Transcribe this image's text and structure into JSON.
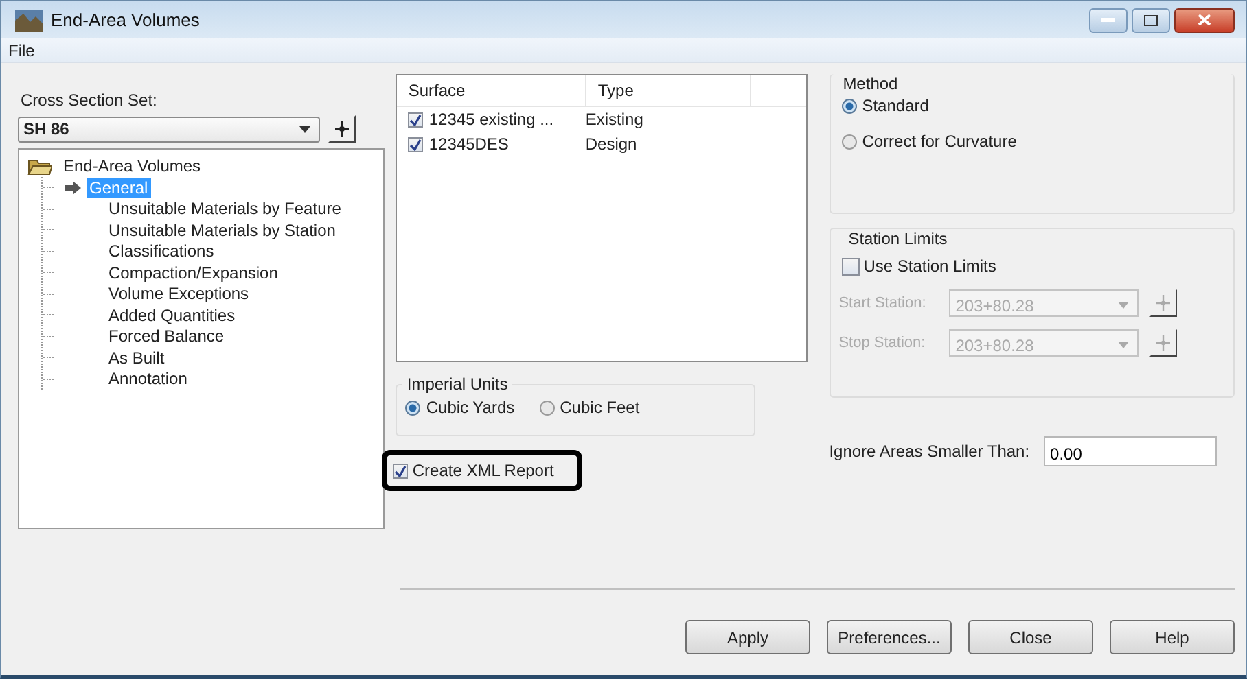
{
  "window": {
    "title": "End-Area Volumes"
  },
  "menu": [
    "File"
  ],
  "cross_section_set": {
    "label": "Cross Section Set:",
    "value": "SH 86"
  },
  "tree": {
    "label": "End-Area Volumes",
    "expanded": true,
    "children": [
      {
        "label": "General",
        "selected": true
      },
      {
        "label": "Unsuitable Materials by Feature",
        "selected": false
      },
      {
        "label": "Unsuitable Materials by Station",
        "selected": false
      },
      {
        "label": "Classifications",
        "selected": false
      },
      {
        "label": "Compaction/Expansion",
        "selected": false
      },
      {
        "label": "Volume Exceptions",
        "selected": false
      },
      {
        "label": "Added Quantities",
        "selected": false
      },
      {
        "label": "Forced Balance",
        "selected": false
      },
      {
        "label": "As Built",
        "selected": false
      },
      {
        "label": "Annotation",
        "selected": false
      }
    ]
  },
  "surfaces": {
    "columns": [
      "Surface",
      "Type"
    ],
    "rows": [
      {
        "surface": "12345 existing ...",
        "type": "Existing",
        "checked": true
      },
      {
        "surface": "12345DES",
        "type": "Design",
        "checked": true
      }
    ]
  },
  "method": {
    "title": "Method",
    "options": [
      {
        "label": "Standard",
        "selected": true
      },
      {
        "label": "Correct for Curvature",
        "selected": false
      }
    ]
  },
  "station_limits": {
    "title": "Station Limits",
    "use": {
      "label": "Use Station Limits",
      "checked": false
    },
    "fields": [
      {
        "label": "Start Station:",
        "value": "203+80.28",
        "disabled": true
      },
      {
        "label": "Stop Station:",
        "value": "203+80.28",
        "disabled": true
      }
    ]
  },
  "units": {
    "title": "Imperial Units",
    "options": [
      {
        "label": "Cubic Yards",
        "selected": true
      },
      {
        "label": "Cubic Feet",
        "selected": false
      }
    ]
  },
  "ignore_areas": {
    "label": "Ignore Areas Smaller Than:",
    "value": "0.00"
  },
  "xml_report": {
    "label": "Create XML Report",
    "checked": true,
    "highlighted": true
  },
  "buttons": [
    "Apply",
    "Preferences...",
    "Close",
    "Help"
  ]
}
